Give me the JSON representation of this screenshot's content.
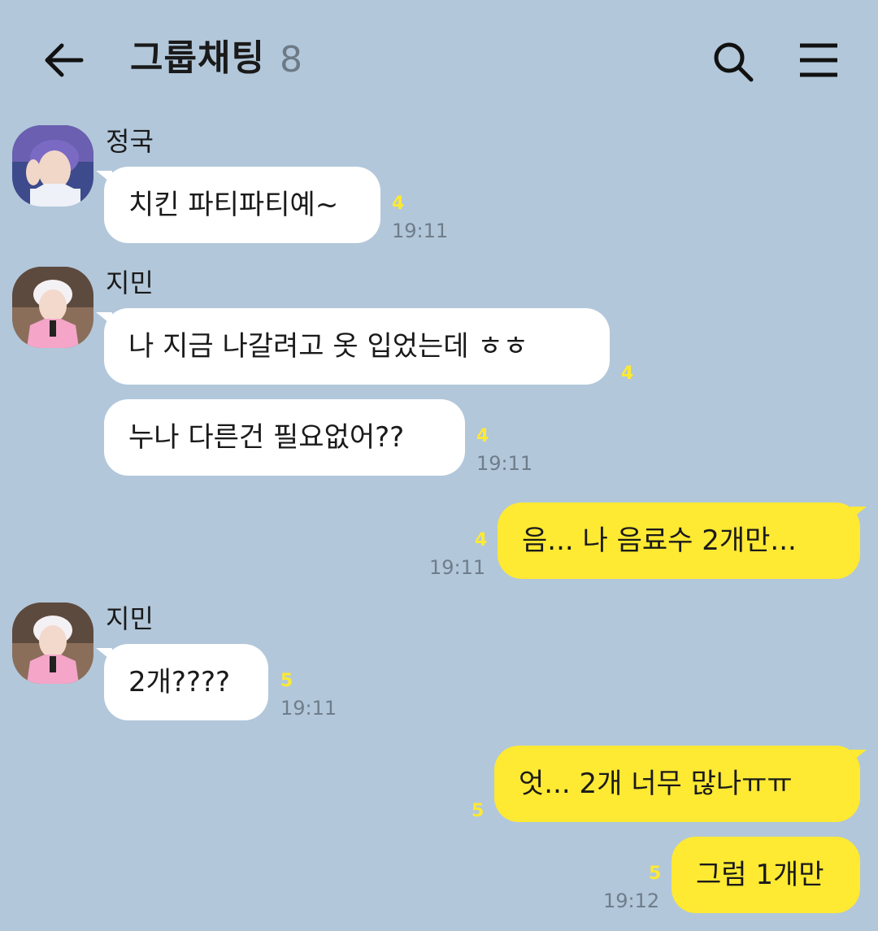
{
  "header": {
    "title": "그룹채팅",
    "member_count": "8"
  },
  "icons": {
    "back": "arrow-left-icon",
    "search": "search-icon",
    "menu": "hamburger-menu-icon"
  },
  "colors": {
    "background": "#b2c7da",
    "incoming_bubble": "#ffffff",
    "outgoing_bubble": "#fee933",
    "unread_count": "#fee933",
    "timestamp": "#6f7d8b"
  },
  "messages": [
    {
      "sender": "정국",
      "text": "치킨 파티파티예~",
      "unread": "4",
      "time": "19:11"
    },
    {
      "sender": "지민",
      "text": "나 지금 나갈려고 옷 입었는데 ㅎㅎ",
      "unread": "4",
      "time": ""
    },
    {
      "sender": "",
      "text": "누나 다른건 필요없어??",
      "unread": "4",
      "time": "19:11"
    },
    {
      "sender": "me",
      "text": "음... 나 음료수 2개만...",
      "unread": "4",
      "time": "19:11"
    },
    {
      "sender": "지민",
      "text": "2개????",
      "unread": "5",
      "time": "19:11"
    },
    {
      "sender": "me",
      "text": "엇... 2개 너무 많나ㅠㅠ",
      "unread": "5",
      "time": ""
    },
    {
      "sender": "me",
      "text": "그럼 1개만",
      "unread": "5",
      "time": "19:12"
    }
  ]
}
